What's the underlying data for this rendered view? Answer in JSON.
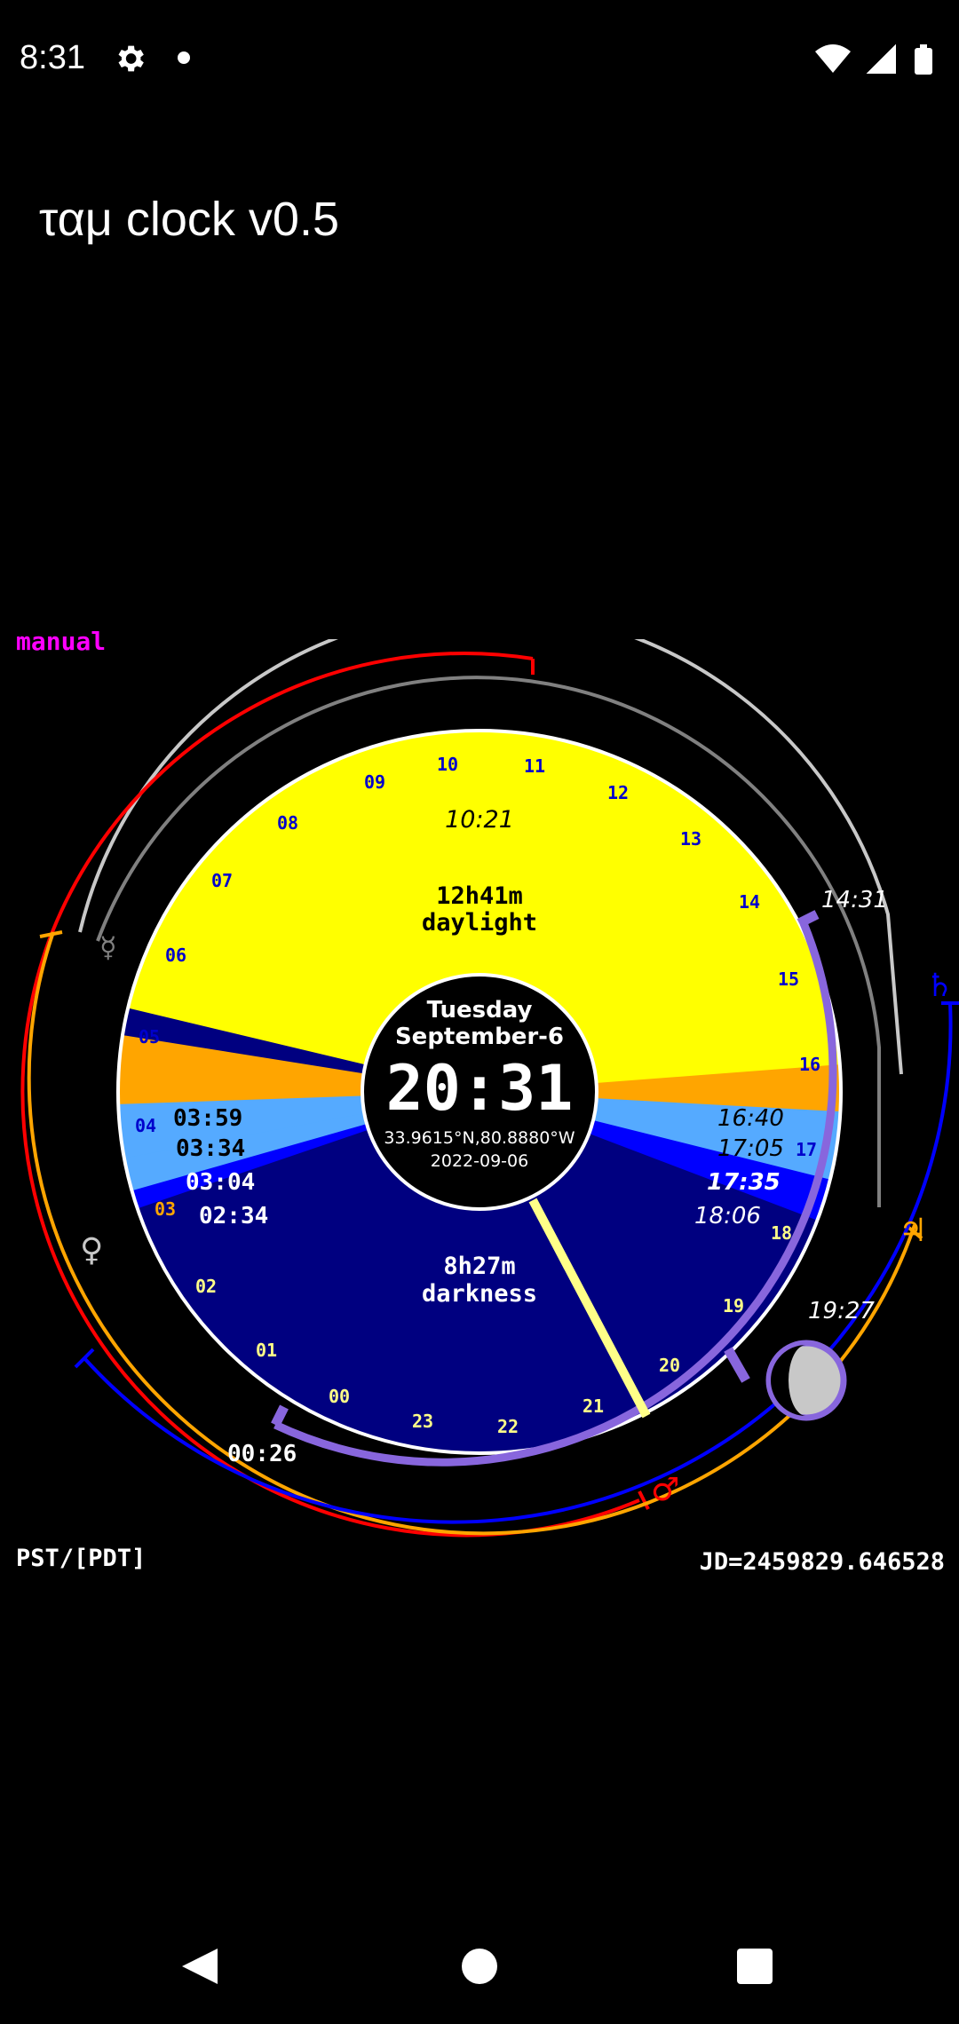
{
  "status_bar": {
    "time": "8:31",
    "icons": [
      "gear-icon",
      "notification-dot-icon",
      "wifi-icon",
      "signal-icon",
      "battery-icon"
    ]
  },
  "app": {
    "title": "ταμ clock v0.5"
  },
  "mode": "manual",
  "clock": {
    "weekday": "Tuesday",
    "date_label": "September-6",
    "time": "20:31",
    "coords": "33.9615°N,80.8880°W",
    "date_iso": "2022-09-06",
    "daylight_duration": "12h41m",
    "daylight_label": "daylight",
    "darkness_duration": "8h27m",
    "darkness_label": "darkness",
    "solar_noon": "10:21",
    "morning_times": [
      "03:59",
      "03:34",
      "03:04",
      "02:34"
    ],
    "evening_times": [
      "16:40",
      "17:05",
      "17:35",
      "18:06"
    ],
    "moonrise": "14:31",
    "moonset": "19:27",
    "moon_other": "00:26",
    "hour_labels": [
      "09",
      "10",
      "11",
      "12",
      "13",
      "14",
      "15",
      "16",
      "17",
      "18",
      "19",
      "20",
      "21",
      "22",
      "23",
      "00",
      "01",
      "02",
      "03",
      "04",
      "05",
      "06",
      "07",
      "08"
    ],
    "planet_symbols": {
      "mercury": "☿",
      "venus": "♀",
      "mars": "♂",
      "jupiter": "♃",
      "saturn": "♄"
    },
    "colors": {
      "day": "#ffff00",
      "civil_twilight": "#ffa500",
      "nautical_twilight": "#55aaff",
      "astro_twilight": "#0000ff",
      "night": "#000080",
      "moon_arc": "#8866dd",
      "mars": "#ff0000",
      "jupiter": "#ffa500",
      "saturn": "#0000ff",
      "venus": "#c8c8c8",
      "mercury": "#808080"
    }
  },
  "timezone": "PST/[PDT]",
  "jd": "JD=2459829.646528",
  "nav": [
    "back-icon",
    "home-icon",
    "recents-icon"
  ]
}
